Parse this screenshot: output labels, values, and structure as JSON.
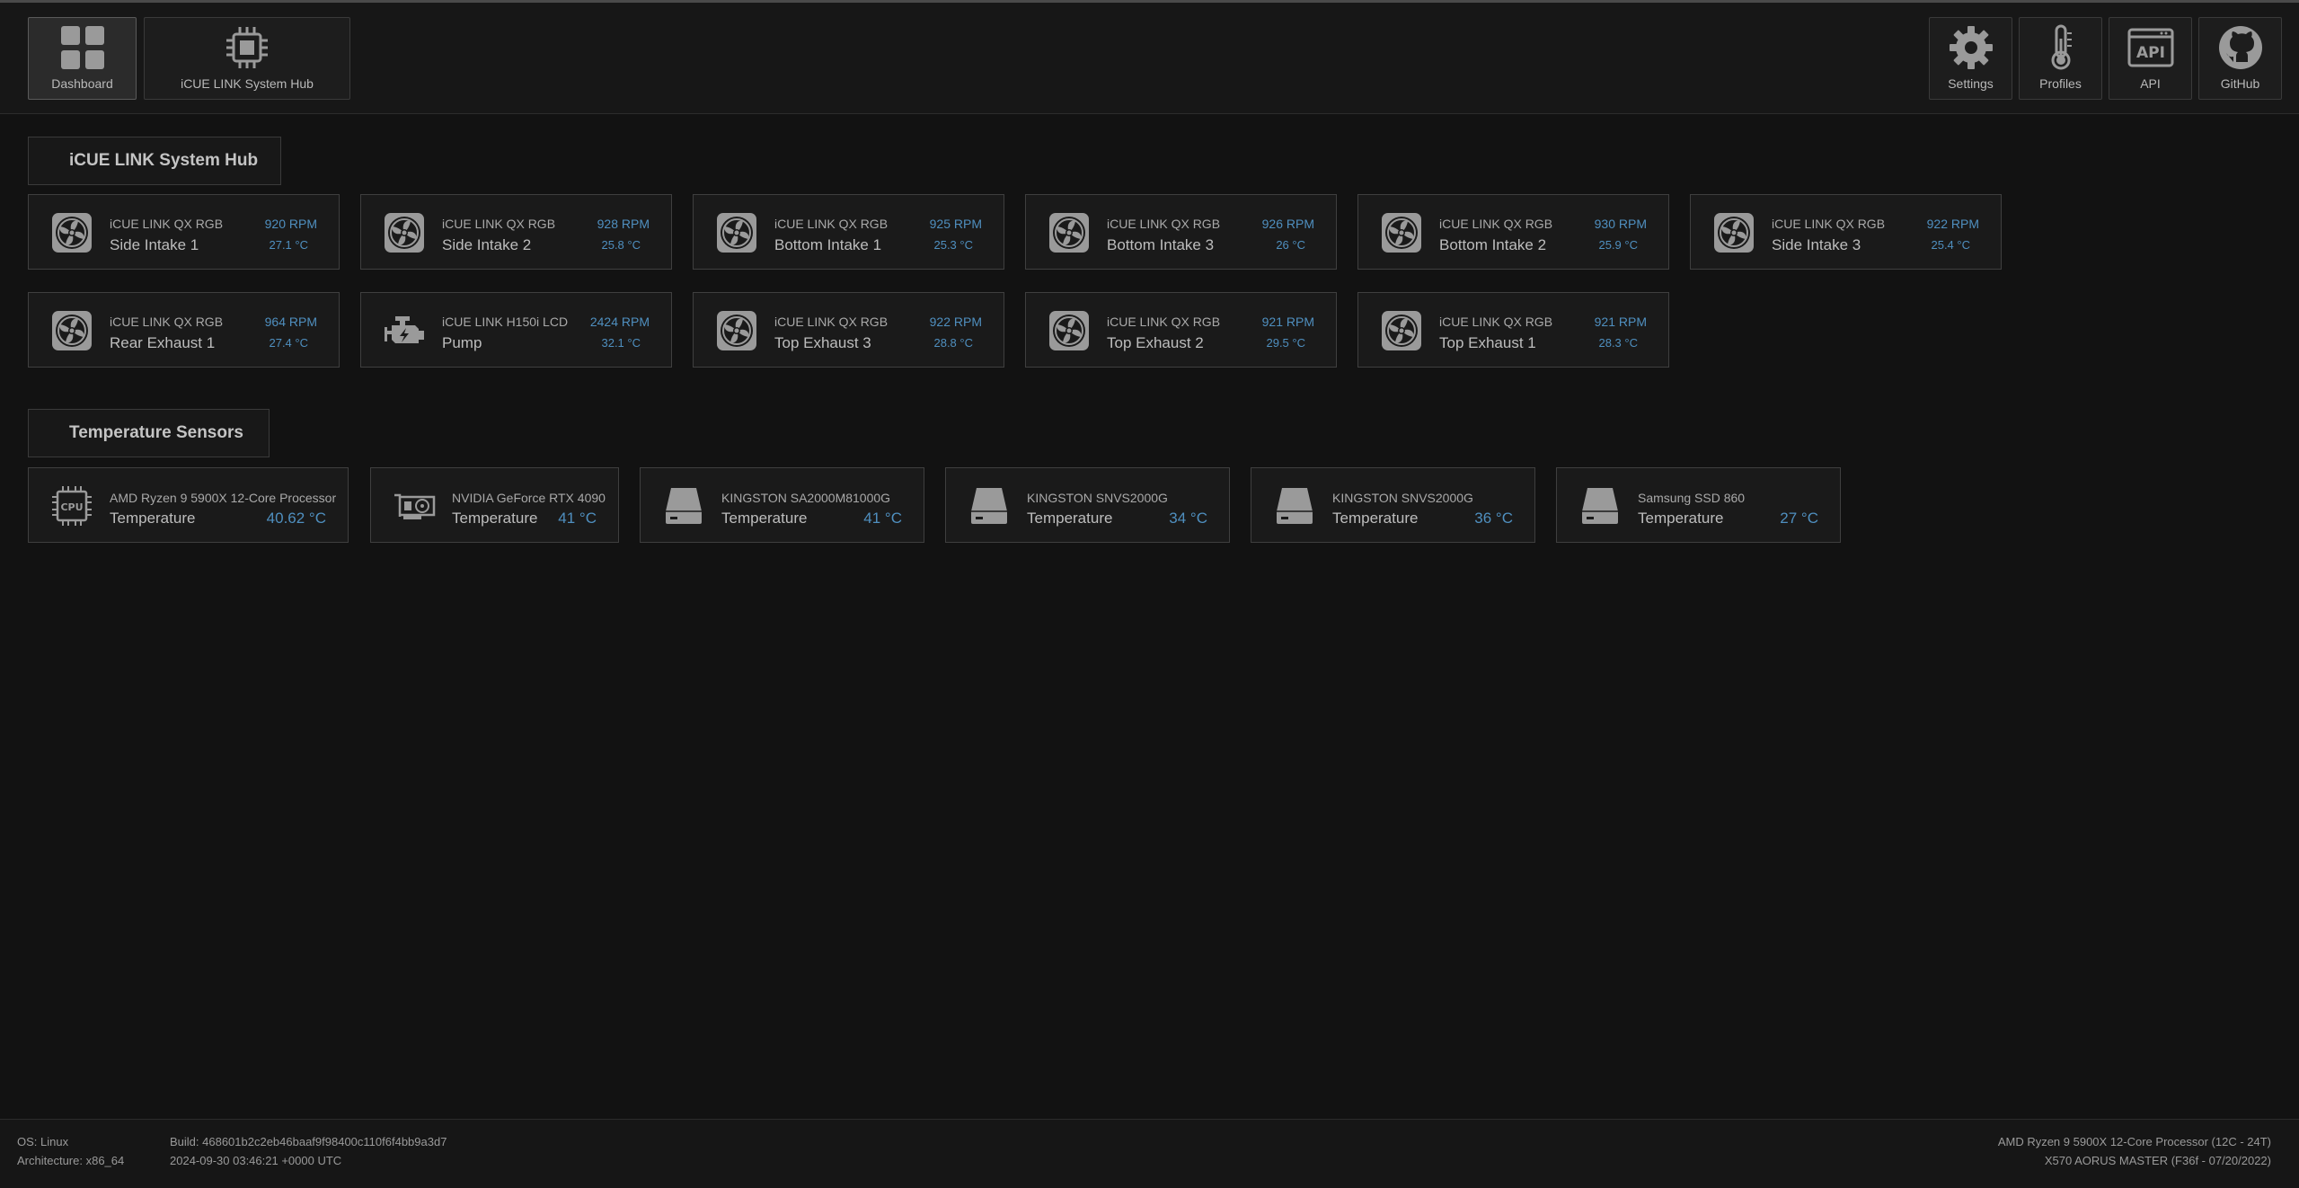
{
  "nav": {
    "left": [
      {
        "label": "Dashboard",
        "icon": "dashboard-icon",
        "active": true
      },
      {
        "label": "iCUE LINK System Hub",
        "icon": "chip-icon",
        "active": false
      }
    ],
    "right": [
      {
        "label": "Settings",
        "icon": "gear-icon"
      },
      {
        "label": "Profiles",
        "icon": "thermometer-icon"
      },
      {
        "label": "API",
        "icon": "api-icon"
      },
      {
        "label": "GitHub",
        "icon": "github-icon"
      }
    ]
  },
  "hub_section": {
    "title": "iCUE LINK System Hub",
    "devices": [
      {
        "model": "iCUE LINK QX RGB",
        "name": "Side Intake 1",
        "rpm": "920 RPM",
        "temp": "27.1 °C",
        "icon": "fan-icon"
      },
      {
        "model": "iCUE LINK QX RGB",
        "name": "Side Intake 2",
        "rpm": "928 RPM",
        "temp": "25.8 °C",
        "icon": "fan-icon"
      },
      {
        "model": "iCUE LINK QX RGB",
        "name": "Bottom Intake 1",
        "rpm": "925 RPM",
        "temp": "25.3 °C",
        "icon": "fan-icon"
      },
      {
        "model": "iCUE LINK QX RGB",
        "name": "Bottom Intake 3",
        "rpm": "926 RPM",
        "temp": "26 °C",
        "icon": "fan-icon"
      },
      {
        "model": "iCUE LINK QX RGB",
        "name": "Bottom Intake 2",
        "rpm": "930 RPM",
        "temp": "25.9 °C",
        "icon": "fan-icon"
      },
      {
        "model": "iCUE LINK QX RGB",
        "name": "Side Intake 3",
        "rpm": "922 RPM",
        "temp": "25.4 °C",
        "icon": "fan-icon"
      },
      {
        "model": "iCUE LINK QX RGB",
        "name": "Rear Exhaust 1",
        "rpm": "964 RPM",
        "temp": "27.4 °C",
        "icon": "fan-icon"
      },
      {
        "model": "iCUE LINK H150i LCD",
        "name": "Pump",
        "rpm": "2424 RPM",
        "temp": "32.1 °C",
        "icon": "pump-icon"
      },
      {
        "model": "iCUE LINK QX RGB",
        "name": "Top Exhaust 3",
        "rpm": "922 RPM",
        "temp": "28.8 °C",
        "icon": "fan-icon"
      },
      {
        "model": "iCUE LINK QX RGB",
        "name": "Top Exhaust 2",
        "rpm": "921 RPM",
        "temp": "29.5 °C",
        "icon": "fan-icon"
      },
      {
        "model": "iCUE LINK QX RGB",
        "name": "Top Exhaust 1",
        "rpm": "921 RPM",
        "temp": "28.3 °C",
        "icon": "fan-icon"
      }
    ]
  },
  "temp_section": {
    "title": "Temperature Sensors",
    "sensors": [
      {
        "name": "AMD Ryzen 9 5900X 12-Core Processor",
        "label": "Temperature",
        "value": "40.62 °C",
        "icon": "cpu-icon"
      },
      {
        "name": "NVIDIA GeForce RTX 4090",
        "label": "Temperature",
        "value": "41 °C",
        "icon": "gpu-icon"
      },
      {
        "name": "KINGSTON SA2000M81000G",
        "label": "Temperature",
        "value": "41 °C",
        "icon": "drive-icon"
      },
      {
        "name": "KINGSTON SNVS2000G",
        "label": "Temperature",
        "value": "34 °C",
        "icon": "drive-icon"
      },
      {
        "name": "KINGSTON SNVS2000G",
        "label": "Temperature",
        "value": "36 °C",
        "icon": "drive-icon"
      },
      {
        "name": "Samsung SSD 860",
        "label": "Temperature",
        "value": "27 °C",
        "icon": "drive-icon"
      }
    ]
  },
  "footer": {
    "os": "OS: Linux",
    "arch": "Architecture: x86_64",
    "build": "Build: 468601b2c2eb46baaf9f98400c110f6f4bb9a3d7",
    "build_time": "2024-09-30 03:46:21 +0000 UTC",
    "cpu": "AMD Ryzen 9 5900X 12-Core Processor (12C - 24T)",
    "board": "X570 AORUS MASTER (F36f - 07/20/2022)"
  },
  "colors": {
    "accent": "#4f8fbf",
    "background": "#121212",
    "card": "#1a1a1a",
    "border": "#3f3f3f"
  }
}
